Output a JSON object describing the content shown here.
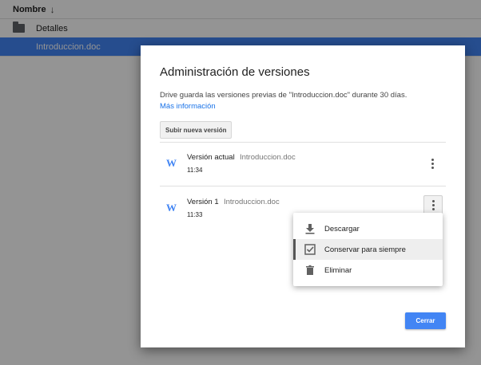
{
  "file_list": {
    "header": {
      "name_label": "Nombre"
    },
    "rows": [
      {
        "name": "Detalles",
        "type": "folder"
      },
      {
        "name": "Introduccion.doc",
        "type": "file"
      }
    ]
  },
  "dialog": {
    "title": "Administración de versiones",
    "description": "Drive guarda las versiones previas de \"Introduccion.doc\" durante 30 días.",
    "more_info_link": "Más información",
    "upload_button": "Subir nueva versión",
    "versions": [
      {
        "label": "Versión actual",
        "file": "Introduccion.doc",
        "time": "11:34",
        "icon": "W"
      },
      {
        "label": "Versión 1",
        "file": "Introduccion.doc",
        "time": "11:33",
        "icon": "W"
      }
    ],
    "close_button": "Cerrar"
  },
  "context_menu": {
    "items": [
      {
        "label": "Descargar",
        "icon": "download-icon"
      },
      {
        "label": "Conservar para siempre",
        "icon": "checkbox-icon"
      },
      {
        "label": "Eliminar",
        "icon": "trash-icon"
      }
    ]
  },
  "colors": {
    "accent": "#4285f4",
    "link": "#1a73e8"
  }
}
